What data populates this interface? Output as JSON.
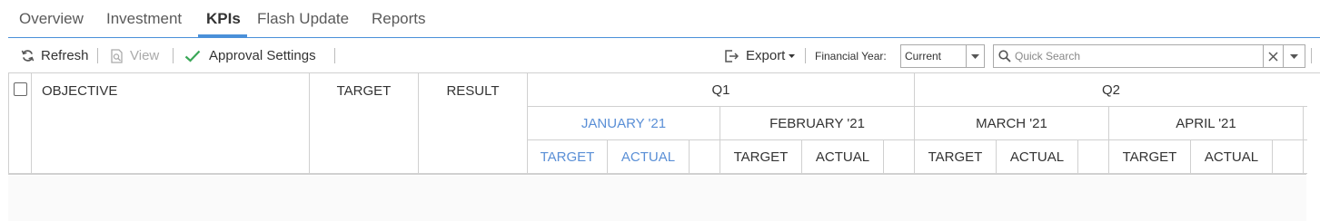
{
  "tabs": [
    {
      "label": "Overview",
      "active": false
    },
    {
      "label": "Investment",
      "active": false
    },
    {
      "label": "KPIs",
      "active": true
    },
    {
      "label": "Flash Update",
      "active": false
    },
    {
      "label": "Reports",
      "active": false
    }
  ],
  "toolbar": {
    "refresh_label": "Refresh",
    "refresh_icon": "refresh-icon",
    "view_label": "View",
    "view_icon": "view-icon",
    "view_disabled": true,
    "approval_label": "Approval Settings",
    "approval_icon": "check-icon",
    "export_label": "Export",
    "export_icon": "export-icon",
    "financial_year_label": "Financial Year:",
    "financial_year_value": "Current",
    "search_placeholder": "Quick Search",
    "accent_color": "#4a90d9",
    "check_color": "#3aa757"
  },
  "grid": {
    "columns": {
      "objective": "OBJECTIVE",
      "target": "TARGET",
      "result": "RESULT"
    },
    "quarters": [
      {
        "label": "Q1"
      },
      {
        "label": "Q2"
      }
    ],
    "months": [
      {
        "label": "JANUARY '21",
        "highlighted": true
      },
      {
        "label": "FEBRUARY '21",
        "highlighted": false
      },
      {
        "label": "MARCH '21",
        "highlighted": false
      },
      {
        "label": "APRIL '21",
        "highlighted": false
      }
    ],
    "sub_headers": {
      "target": "TARGET",
      "actual": "ACTUAL"
    },
    "highlight_color": "#5a8fd6"
  }
}
